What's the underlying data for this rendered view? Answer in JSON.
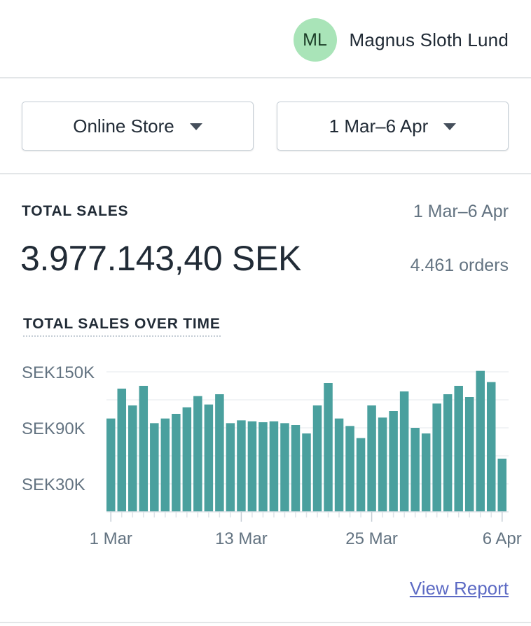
{
  "user": {
    "initials": "ML",
    "name": "Magnus Sloth Lund",
    "avatar_color": "#a9e4b8"
  },
  "filters": {
    "store": "Online Store",
    "date_range": "1 Mar–6 Apr"
  },
  "summary": {
    "label": "TOTAL SALES",
    "range": "1 Mar–6 Apr",
    "total": "3.977.143,40 SEK",
    "orders": "4.461 orders"
  },
  "chart_title": "TOTAL SALES OVER TIME",
  "view_report": "View Report",
  "colors": {
    "bar": "#4aa09e",
    "link": "#5c6ac4"
  },
  "chart_data": {
    "type": "bar",
    "title": "TOTAL SALES OVER TIME",
    "ylim": [
      0,
      150000
    ],
    "y_ticks": [
      30000,
      90000,
      150000
    ],
    "y_tick_labels": [
      "SEK30K",
      "SEK90K",
      "SEK150K"
    ],
    "x_tick_labels": [
      "1 Mar",
      "13 Mar",
      "25 Mar",
      "6 Apr"
    ],
    "grid": true,
    "categories": [
      "1 Mar",
      "2 Mar",
      "3 Mar",
      "4 Mar",
      "5 Mar",
      "6 Mar",
      "7 Mar",
      "8 Mar",
      "9 Mar",
      "10 Mar",
      "11 Mar",
      "12 Mar",
      "13 Mar",
      "14 Mar",
      "15 Mar",
      "16 Mar",
      "17 Mar",
      "18 Mar",
      "19 Mar",
      "20 Mar",
      "21 Mar",
      "22 Mar",
      "23 Mar",
      "24 Mar",
      "25 Mar",
      "26 Mar",
      "27 Mar",
      "28 Mar",
      "29 Mar",
      "30 Mar",
      "31 Mar",
      "1 Apr",
      "2 Apr",
      "3 Apr",
      "4 Apr",
      "5 Apr",
      "6 Apr"
    ],
    "values": [
      100000,
      132000,
      114000,
      135000,
      95000,
      100000,
      105000,
      112000,
      124000,
      115000,
      126000,
      95000,
      98000,
      97000,
      96000,
      97000,
      95000,
      93000,
      84000,
      114000,
      138000,
      100000,
      92000,
      79000,
      114000,
      101000,
      108000,
      129000,
      90000,
      84000,
      116000,
      126000,
      135000,
      123000,
      151000,
      139000,
      57000
    ]
  }
}
